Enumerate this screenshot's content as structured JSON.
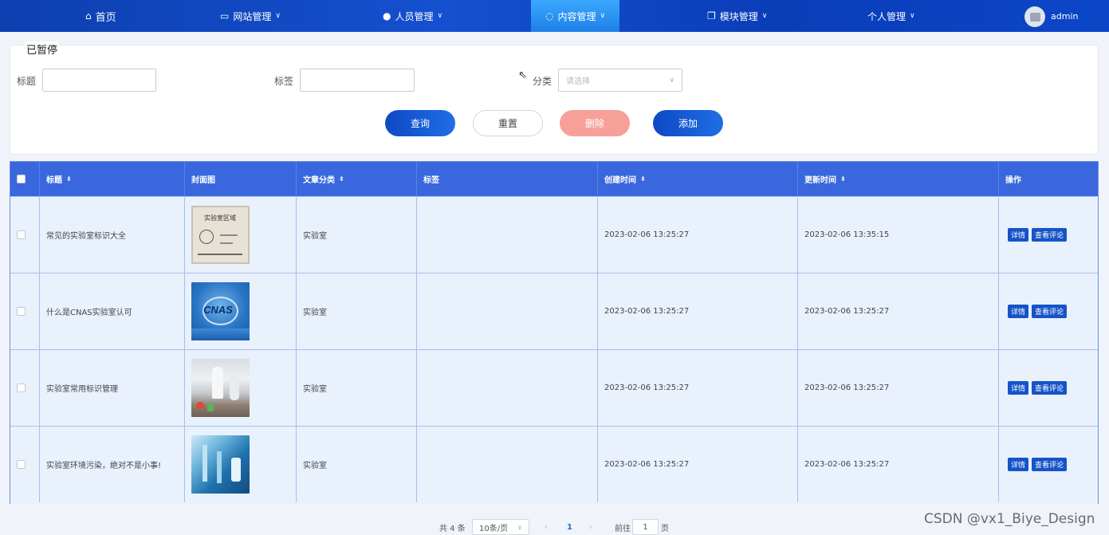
{
  "nav": {
    "home": "首页",
    "site": "网站管理",
    "people": "人员管理",
    "content": "内容管理",
    "module": "模块管理",
    "personal": "个人管理",
    "user": "admin"
  },
  "filter": {
    "tag": "已暂停",
    "title_label": "标题",
    "tag_label": "标签",
    "category_label": "分类",
    "category_placeholder": "请选择",
    "query": "查询",
    "reset": "重置",
    "delete": "删除",
    "add": "添加"
  },
  "table": {
    "headers": [
      "标题",
      "封面图",
      "文章分类",
      "标签",
      "创建时间",
      "更新时间",
      "操作"
    ],
    "rows": [
      {
        "title": "常见的实验室标识大全",
        "category": "实验室",
        "tag": "",
        "created": "2023-02-06 13:25:27",
        "updated": "2023-02-06 13:35:15"
      },
      {
        "title": "什么是CNAS实验室认可",
        "category": "实验室",
        "tag": "",
        "created": "2023-02-06 13:25:27",
        "updated": "2023-02-06 13:25:27"
      },
      {
        "title": "实验室常用标识管理",
        "category": "实验室",
        "tag": "",
        "created": "2023-02-06 13:25:27",
        "updated": "2023-02-06 13:25:27"
      },
      {
        "title": "实验室环境污染，绝对不是小事!",
        "category": "实验室",
        "tag": "",
        "created": "2023-02-06 13:25:27",
        "updated": "2023-02-06 13:25:27"
      }
    ],
    "detail": "详情",
    "comments": "查看评论",
    "thumb1_text": "实验室区域",
    "thumb2_text": "CNAS"
  },
  "pager": {
    "total": "共 4 条",
    "size": "10条/页",
    "page": "1",
    "goto": "前往",
    "goto_value": "1",
    "page_unit": "页"
  },
  "watermark": "CSDN @vx1_Biye_Design"
}
